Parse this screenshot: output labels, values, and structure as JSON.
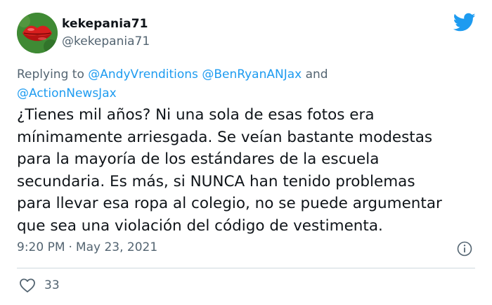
{
  "author": {
    "display_name": "kekepania71",
    "handle": "@kekepania71",
    "avatar_icon": "red-lips-avatar"
  },
  "brand": {
    "logo_icon": "twitter-bird-icon",
    "color": "#1d9bf0"
  },
  "reply_context": {
    "prefix": "Replying to",
    "mentions": [
      "@AndyVrenditions",
      "@BenRyanANJax",
      "@ActionNewsJax"
    ],
    "conjunction": "and"
  },
  "tweet": {
    "lines": [
      "¿Tienes mil años? Ni una sola de esas fotos era",
      "mínimamente arriesgada. Se veían bastante modestas",
      "para la mayoría de los estándares de la escuela",
      "secundaria. Es más, si NUNCA han tenido problemas",
      "para llevar esa ropa al colegio, no se puede argumentar",
      "que sea una violación del código de vestimenta."
    ]
  },
  "meta": {
    "time": "9:20 PM",
    "separator": "·",
    "date": "May 23, 2021",
    "info_icon": "info-icon"
  },
  "stats": {
    "like_icon": "heart-icon",
    "likes": "33"
  },
  "colors": {
    "text": "#0f1419",
    "secondary": "#536471",
    "link": "#1d9bf0",
    "divider": "#cfd9de"
  }
}
